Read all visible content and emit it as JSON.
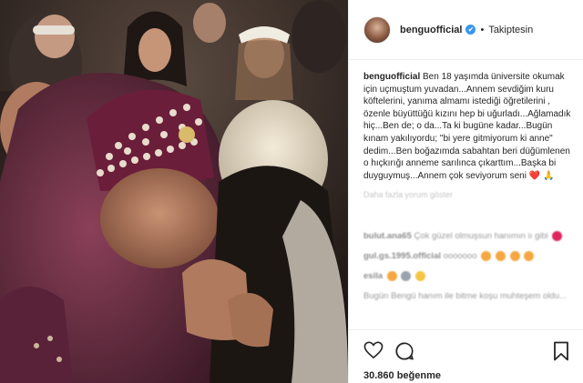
{
  "post": {
    "username": "benguofficial",
    "verified_mark": "✔",
    "separator": "•",
    "follow_status": "Takiptesin",
    "caption_user": "benguofficial",
    "caption_text": "Ben 18 yaşımda üniversite okumak için uçmuştum yuvadan...Annem sevdiğim kuru köftelerini, yanıma almamı istediği öğretilerini , özenle büyüttüğü kızını hep bi uğurladı...Ağlamadık hiç...Ben de; o da...Ta ki bugüne kadar...Bugün kınam yakılıyordu; \"bi yere gitmiyorum ki anne\" dedim...Ben boğazımda sabahtan beri düğümlenen o hıçkırığı anneme sarılınca çıkarttım...Başka bi duyguymuş...Annem çok seviyorum seni",
    "caption_emoji_1": "❤️",
    "caption_emoji_2": "🙏",
    "caption_time": "Daha fazla yorum göster",
    "likes": "30.860 beğenme"
  },
  "comments": [
    {
      "user": "bulut.ana65",
      "text": "Çok güzel olmuşsun hanımın iı gibi",
      "emoji_colors": [
        "#e0245e"
      ]
    },
    {
      "user": "gul.gs.1995.official",
      "text": "ooooooo",
      "emoji_colors": [
        "#f4a742",
        "#f4a742",
        "#f4a742",
        "#f4a742"
      ]
    },
    {
      "user": "esila",
      "text": "",
      "emoji_colors": [
        "#f4a742",
        "#9aa3ad",
        "#f4c542"
      ]
    },
    {
      "user": "",
      "text": "Bugün Bengü hanım ile bitme koşu muhteşem oldu...",
      "emoji_colors": []
    }
  ],
  "icons": {
    "avatar": "profile-avatar",
    "like": "heart-icon",
    "comment": "comment-icon",
    "save": "bookmark-icon",
    "verified": "verified-badge-icon"
  },
  "colors": {
    "verified_blue": "#3897f0",
    "text": "#262626",
    "border": "#efefef"
  }
}
